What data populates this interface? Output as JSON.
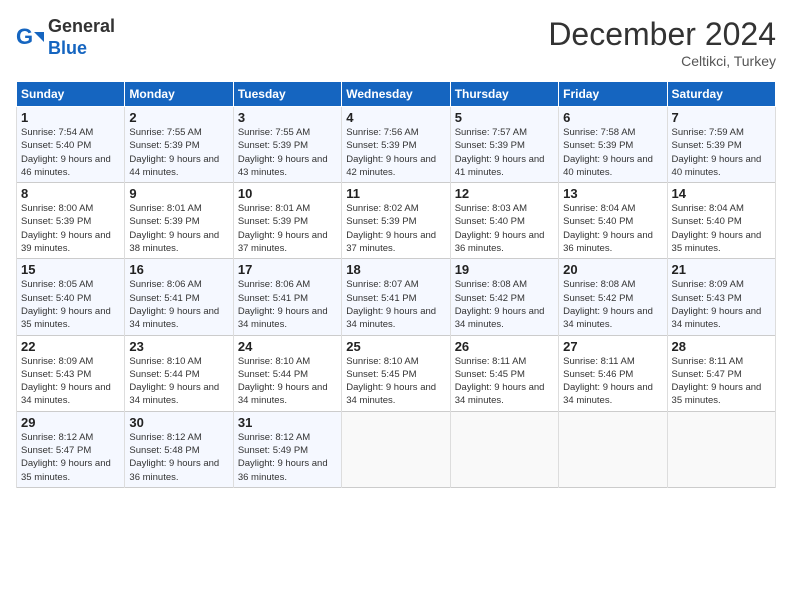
{
  "header": {
    "logo_line1": "General",
    "logo_line2": "Blue",
    "month_title": "December 2024",
    "subtitle": "Celtikci, Turkey"
  },
  "days_of_week": [
    "Sunday",
    "Monday",
    "Tuesday",
    "Wednesday",
    "Thursday",
    "Friday",
    "Saturday"
  ],
  "weeks": [
    [
      {
        "day": "1",
        "info": "Sunrise: 7:54 AM\nSunset: 5:40 PM\nDaylight: 9 hours and 46 minutes."
      },
      {
        "day": "2",
        "info": "Sunrise: 7:55 AM\nSunset: 5:39 PM\nDaylight: 9 hours and 44 minutes."
      },
      {
        "day": "3",
        "info": "Sunrise: 7:55 AM\nSunset: 5:39 PM\nDaylight: 9 hours and 43 minutes."
      },
      {
        "day": "4",
        "info": "Sunrise: 7:56 AM\nSunset: 5:39 PM\nDaylight: 9 hours and 42 minutes."
      },
      {
        "day": "5",
        "info": "Sunrise: 7:57 AM\nSunset: 5:39 PM\nDaylight: 9 hours and 41 minutes."
      },
      {
        "day": "6",
        "info": "Sunrise: 7:58 AM\nSunset: 5:39 PM\nDaylight: 9 hours and 40 minutes."
      },
      {
        "day": "7",
        "info": "Sunrise: 7:59 AM\nSunset: 5:39 PM\nDaylight: 9 hours and 40 minutes."
      }
    ],
    [
      {
        "day": "8",
        "info": "Sunrise: 8:00 AM\nSunset: 5:39 PM\nDaylight: 9 hours and 39 minutes."
      },
      {
        "day": "9",
        "info": "Sunrise: 8:01 AM\nSunset: 5:39 PM\nDaylight: 9 hours and 38 minutes."
      },
      {
        "day": "10",
        "info": "Sunrise: 8:01 AM\nSunset: 5:39 PM\nDaylight: 9 hours and 37 minutes."
      },
      {
        "day": "11",
        "info": "Sunrise: 8:02 AM\nSunset: 5:39 PM\nDaylight: 9 hours and 37 minutes."
      },
      {
        "day": "12",
        "info": "Sunrise: 8:03 AM\nSunset: 5:40 PM\nDaylight: 9 hours and 36 minutes."
      },
      {
        "day": "13",
        "info": "Sunrise: 8:04 AM\nSunset: 5:40 PM\nDaylight: 9 hours and 36 minutes."
      },
      {
        "day": "14",
        "info": "Sunrise: 8:04 AM\nSunset: 5:40 PM\nDaylight: 9 hours and 35 minutes."
      }
    ],
    [
      {
        "day": "15",
        "info": "Sunrise: 8:05 AM\nSunset: 5:40 PM\nDaylight: 9 hours and 35 minutes."
      },
      {
        "day": "16",
        "info": "Sunrise: 8:06 AM\nSunset: 5:41 PM\nDaylight: 9 hours and 34 minutes."
      },
      {
        "day": "17",
        "info": "Sunrise: 8:06 AM\nSunset: 5:41 PM\nDaylight: 9 hours and 34 minutes."
      },
      {
        "day": "18",
        "info": "Sunrise: 8:07 AM\nSunset: 5:41 PM\nDaylight: 9 hours and 34 minutes."
      },
      {
        "day": "19",
        "info": "Sunrise: 8:08 AM\nSunset: 5:42 PM\nDaylight: 9 hours and 34 minutes."
      },
      {
        "day": "20",
        "info": "Sunrise: 8:08 AM\nSunset: 5:42 PM\nDaylight: 9 hours and 34 minutes."
      },
      {
        "day": "21",
        "info": "Sunrise: 8:09 AM\nSunset: 5:43 PM\nDaylight: 9 hours and 34 minutes."
      }
    ],
    [
      {
        "day": "22",
        "info": "Sunrise: 8:09 AM\nSunset: 5:43 PM\nDaylight: 9 hours and 34 minutes."
      },
      {
        "day": "23",
        "info": "Sunrise: 8:10 AM\nSunset: 5:44 PM\nDaylight: 9 hours and 34 minutes."
      },
      {
        "day": "24",
        "info": "Sunrise: 8:10 AM\nSunset: 5:44 PM\nDaylight: 9 hours and 34 minutes."
      },
      {
        "day": "25",
        "info": "Sunrise: 8:10 AM\nSunset: 5:45 PM\nDaylight: 9 hours and 34 minutes."
      },
      {
        "day": "26",
        "info": "Sunrise: 8:11 AM\nSunset: 5:45 PM\nDaylight: 9 hours and 34 minutes."
      },
      {
        "day": "27",
        "info": "Sunrise: 8:11 AM\nSunset: 5:46 PM\nDaylight: 9 hours and 34 minutes."
      },
      {
        "day": "28",
        "info": "Sunrise: 8:11 AM\nSunset: 5:47 PM\nDaylight: 9 hours and 35 minutes."
      }
    ],
    [
      {
        "day": "29",
        "info": "Sunrise: 8:12 AM\nSunset: 5:47 PM\nDaylight: 9 hours and 35 minutes."
      },
      {
        "day": "30",
        "info": "Sunrise: 8:12 AM\nSunset: 5:48 PM\nDaylight: 9 hours and 36 minutes."
      },
      {
        "day": "31",
        "info": "Sunrise: 8:12 AM\nSunset: 5:49 PM\nDaylight: 9 hours and 36 minutes."
      },
      {
        "day": "",
        "info": ""
      },
      {
        "day": "",
        "info": ""
      },
      {
        "day": "",
        "info": ""
      },
      {
        "day": "",
        "info": ""
      }
    ]
  ]
}
